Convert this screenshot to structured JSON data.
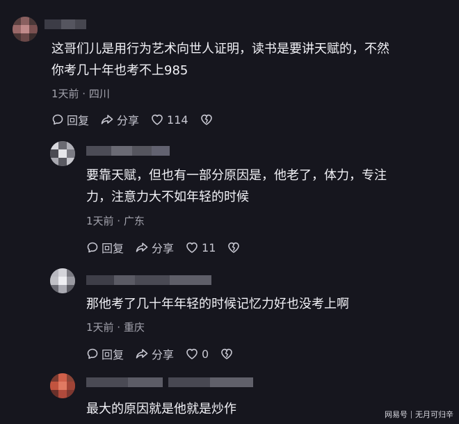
{
  "colors": {
    "background": "#16161e",
    "text": "#f2f2f7",
    "meta": "#a3a3ad",
    "icon": "#c8c8d2"
  },
  "actions": {
    "reply": "回复",
    "share": "分享"
  },
  "comments": [
    {
      "text": "这哥们儿是用行为艺术向世人证明，读书是要讲天赋的，不然\n你考几十年也考不上985",
      "meta": "1天前 · 四川",
      "likes": "114"
    },
    {
      "text": "要靠天赋，但也有一部分原因是，他老了，体力，专注\n力，注意力大不如年轻的时候",
      "meta": "1天前 · 广东",
      "likes": "11"
    },
    {
      "text": "那他考了几十年年轻的时候记忆力好也没考上啊",
      "meta": "1天前 · 重庆",
      "likes": "0"
    },
    {
      "text": "最大的原因就是他就是炒作"
    }
  ],
  "watermark": {
    "platform": "网易号",
    "author": "无月可归辛"
  }
}
